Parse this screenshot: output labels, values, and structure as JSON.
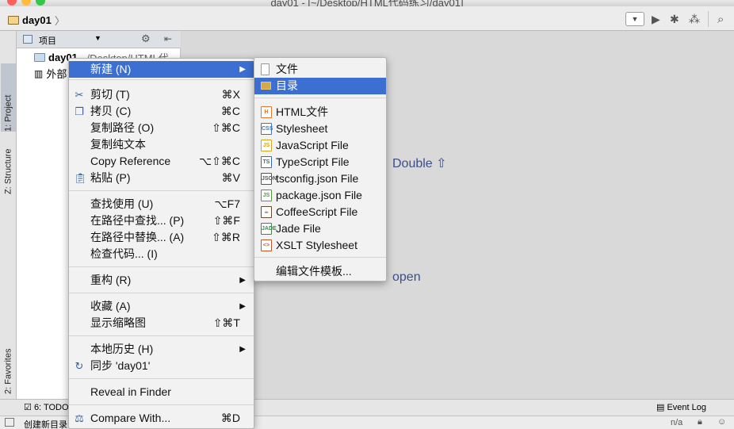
{
  "window": {
    "title": "day01 - [~/Desktop/HTML代码练习/day01]"
  },
  "navbar": {
    "breadcrumb": "day01"
  },
  "side_tabs": {
    "project": "1: Project",
    "structure": "Z: Structure",
    "favorites": "2: Favorites"
  },
  "project_panel": {
    "header_label": "项目",
    "tree": [
      {
        "label": "day01",
        "path": "~/Desktop/HTML代"
      },
      {
        "label": "外部"
      }
    ]
  },
  "editor_hints": {
    "search": "Double ⇧",
    "open": "open"
  },
  "bottom": {
    "todo": "6: TODO",
    "event_log": "Event Log"
  },
  "status": {
    "text": "创建新目录",
    "position": "n/a"
  },
  "context_menu": {
    "items": [
      {
        "label": "新建 (N)",
        "shortcut": "",
        "submenu": true
      },
      {
        "label": "剪切 (T)",
        "shortcut": "⌘X",
        "icon": "scissors-icon"
      },
      {
        "label": "拷贝 (C)",
        "shortcut": "⌘C",
        "icon": "copy-icon"
      },
      {
        "label": "复制路径 (O)",
        "shortcut": "⇧⌘C"
      },
      {
        "label": "复制纯文本",
        "shortcut": ""
      },
      {
        "label": "Copy Reference",
        "shortcut": "⌥⇧⌘C"
      },
      {
        "label": "粘贴 (P)",
        "shortcut": "⌘V",
        "icon": "paste-icon"
      },
      {
        "label": "查找使用 (U)",
        "shortcut": "⌥F7"
      },
      {
        "label": "在路径中查找... (P)",
        "shortcut": "⇧⌘F"
      },
      {
        "label": "在路径中替换... (A)",
        "shortcut": "⇧⌘R"
      },
      {
        "label": "检查代码... (I)",
        "shortcut": ""
      },
      {
        "label": "重构 (R)",
        "shortcut": "",
        "submenu": true
      },
      {
        "label": "收藏 (A)",
        "shortcut": "",
        "submenu": true
      },
      {
        "label": "显示缩略图",
        "shortcut": "⇧⌘T"
      },
      {
        "label": "本地历史 (H)",
        "shortcut": "",
        "submenu": true
      },
      {
        "label": "同步 'day01'",
        "shortcut": "",
        "icon": "sync-icon"
      },
      {
        "label": "Reveal in Finder",
        "shortcut": ""
      },
      {
        "label": "Compare With...",
        "shortcut": "⌘D",
        "icon": "compare-icon"
      }
    ]
  },
  "new_submenu": {
    "items": [
      {
        "label": "文件",
        "icon": "file-icon"
      },
      {
        "label": "目录",
        "icon": "folder-icon"
      },
      {
        "label": "HTML文件",
        "icon": "html-file-icon",
        "badge": "H"
      },
      {
        "label": "Stylesheet",
        "icon": "css-file-icon",
        "badge": "CSS"
      },
      {
        "label": "JavaScript File",
        "icon": "js-file-icon",
        "badge": "JS"
      },
      {
        "label": "TypeScript File",
        "icon": "ts-file-icon",
        "badge": "TS"
      },
      {
        "label": "tsconfig.json File",
        "icon": "json-file-icon",
        "badge": "JSON"
      },
      {
        "label": "package.json File",
        "icon": "nodejs-icon",
        "badge": "JS"
      },
      {
        "label": "CoffeeScript File",
        "icon": "coffee-icon",
        "badge": "☕"
      },
      {
        "label": "Jade File",
        "icon": "jade-file-icon",
        "badge": "JADE"
      },
      {
        "label": "XSLT Stylesheet",
        "icon": "xslt-file-icon",
        "badge": "<>"
      },
      {
        "label": "编辑文件模板...",
        "icon": ""
      }
    ]
  },
  "colors": {
    "selection": "#3d6fd2",
    "hint_text": "#3d4e8a"
  }
}
